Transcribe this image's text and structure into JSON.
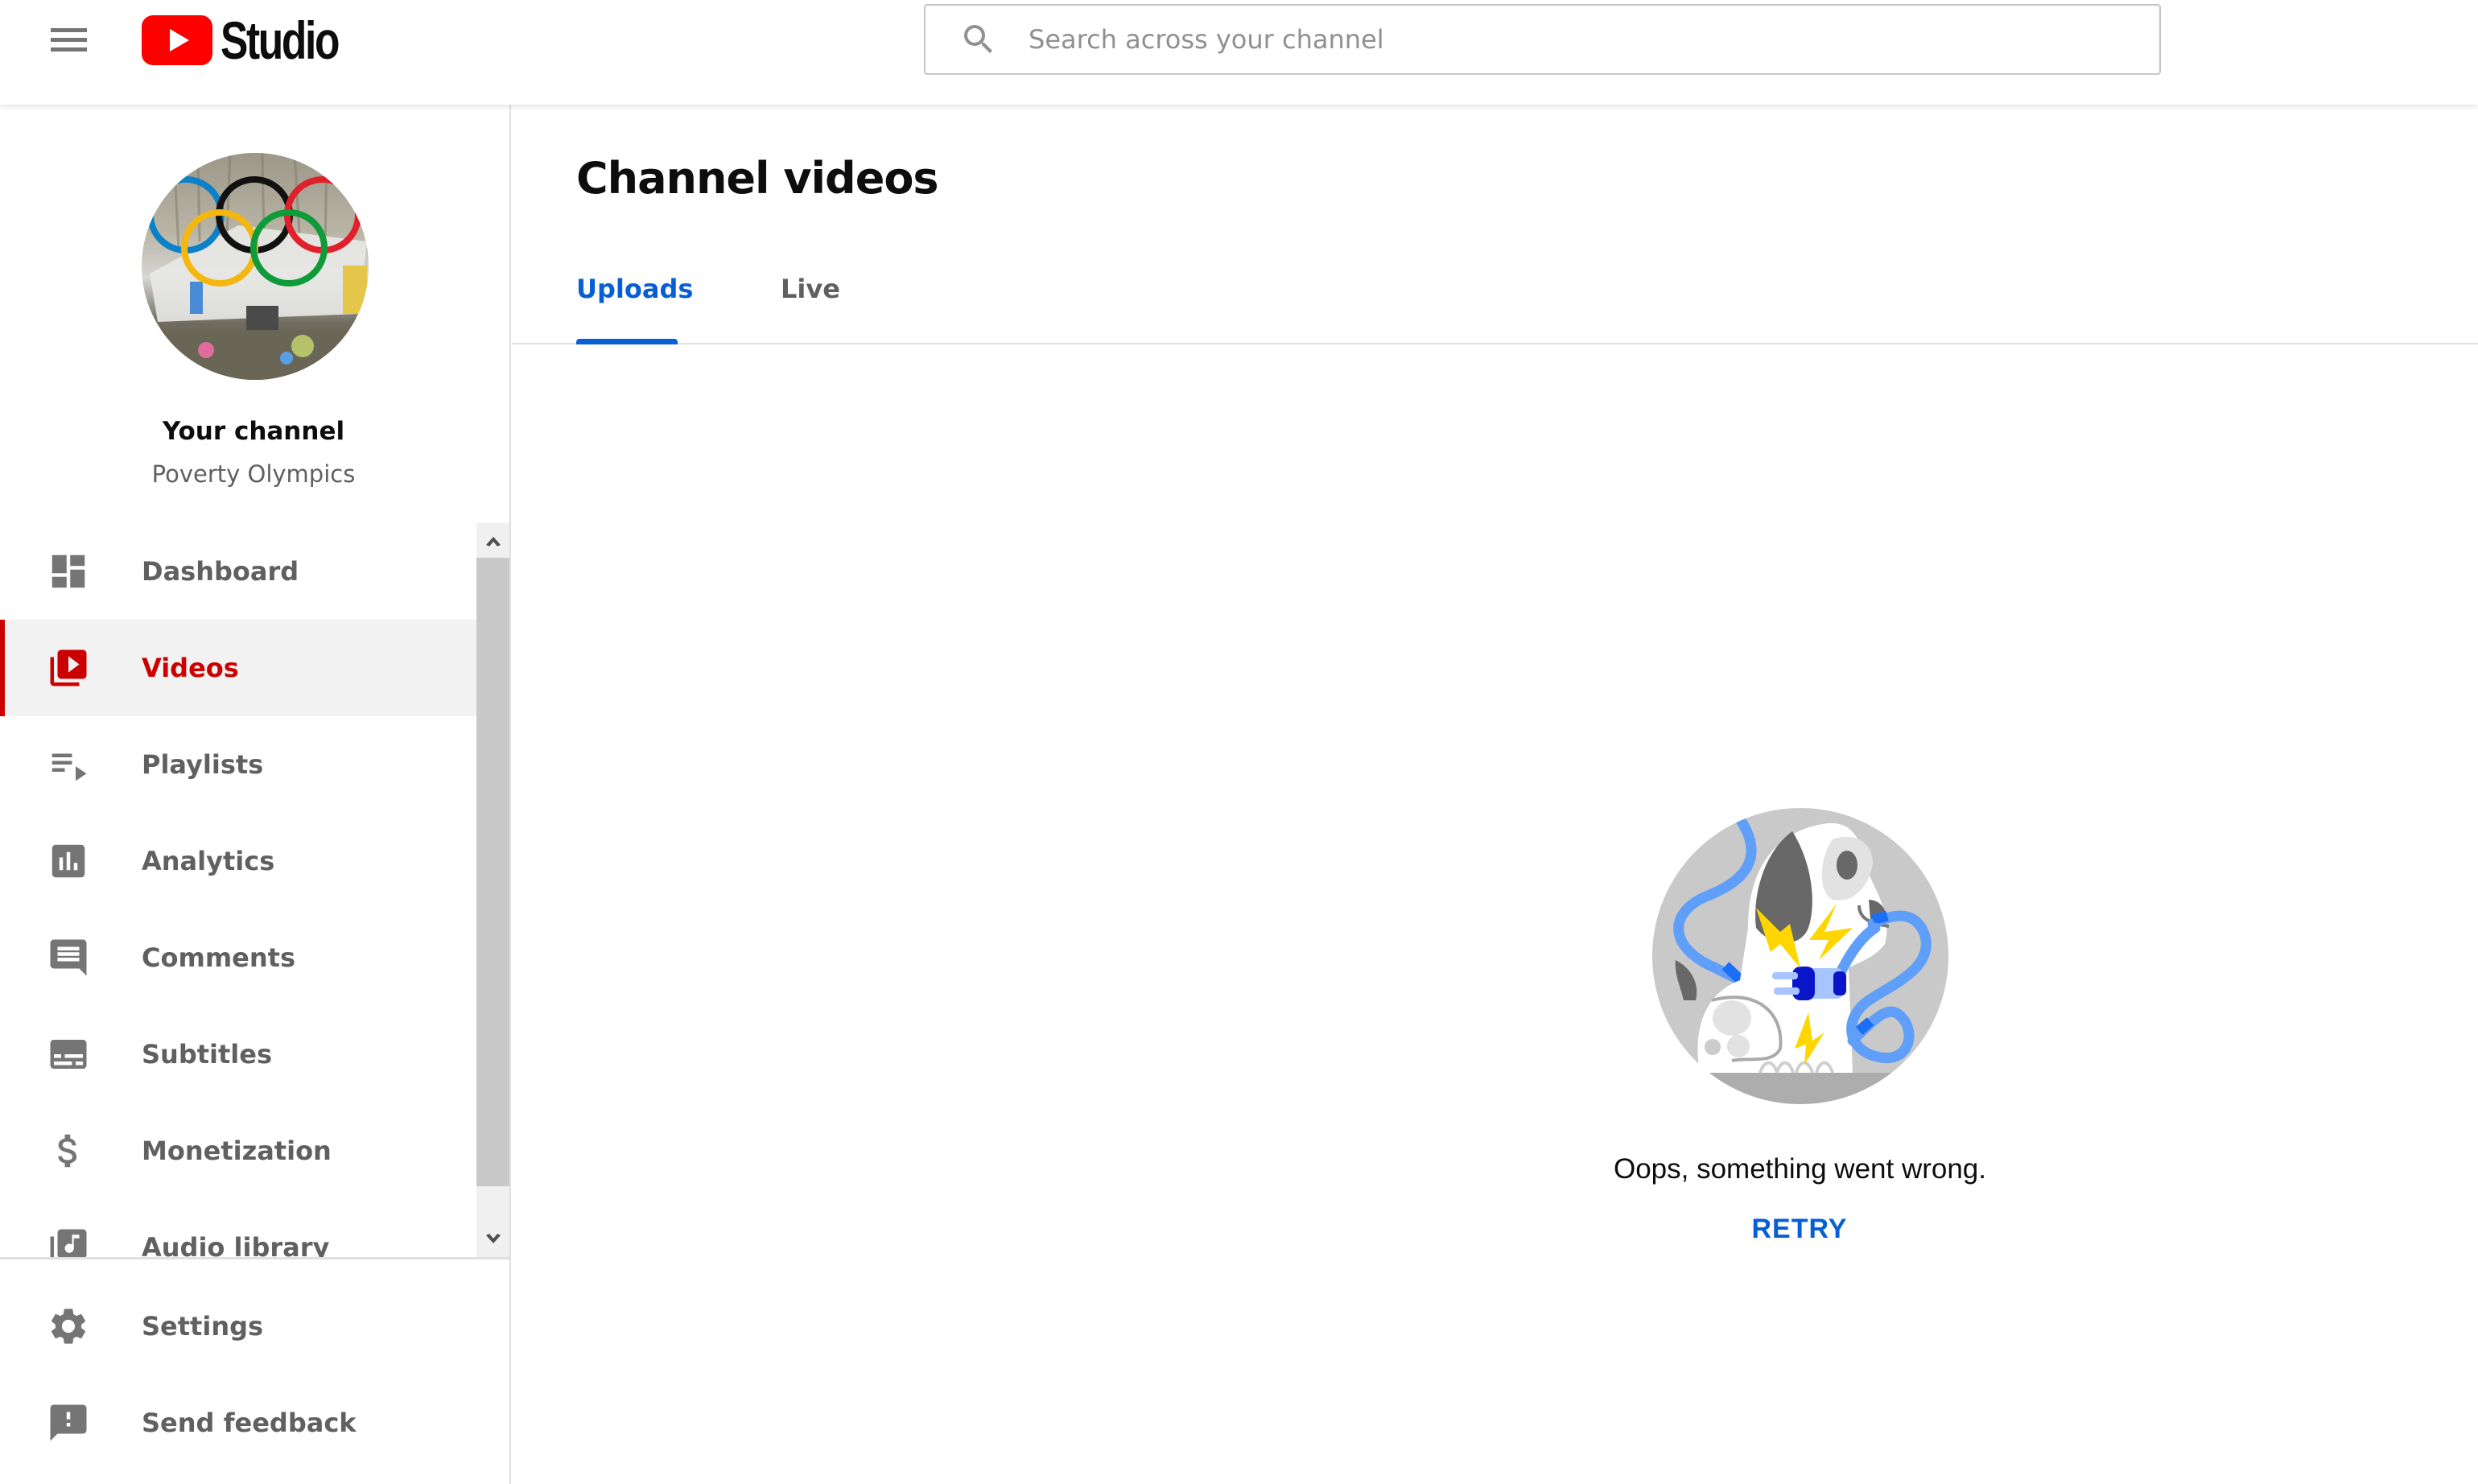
{
  "header": {
    "app_name": "Studio",
    "search_placeholder": "Search across your channel",
    "search_value": ""
  },
  "channel": {
    "title": "Your channel",
    "name": "Poverty Olympics"
  },
  "sidebar": {
    "items": [
      {
        "label": "Dashboard",
        "icon": "dashboard-icon",
        "active": false
      },
      {
        "label": "Videos",
        "icon": "videos-icon",
        "active": true
      },
      {
        "label": "Playlists",
        "icon": "playlists-icon",
        "active": false
      },
      {
        "label": "Analytics",
        "icon": "analytics-icon",
        "active": false
      },
      {
        "label": "Comments",
        "icon": "comments-icon",
        "active": false
      },
      {
        "label": "Subtitles",
        "icon": "subtitles-icon",
        "active": false
      },
      {
        "label": "Monetization",
        "icon": "monetization-icon",
        "active": false
      },
      {
        "label": "Audio library",
        "icon": "audio-library-icon",
        "active": false
      }
    ],
    "bottom_items": [
      {
        "label": "Settings",
        "icon": "settings-icon"
      },
      {
        "label": "Send feedback",
        "icon": "feedback-icon"
      }
    ]
  },
  "main": {
    "title": "Channel videos",
    "tabs": [
      {
        "label": "Uploads",
        "active": true
      },
      {
        "label": "Live",
        "active": false
      }
    ],
    "error": {
      "message": "Oops, something went wrong.",
      "retry_label": "RETRY"
    }
  },
  "colors": {
    "brand_red": "#ff0000",
    "active_red": "#cc0000",
    "accent_blue": "#065fd4",
    "icon_gray": "#757575"
  }
}
